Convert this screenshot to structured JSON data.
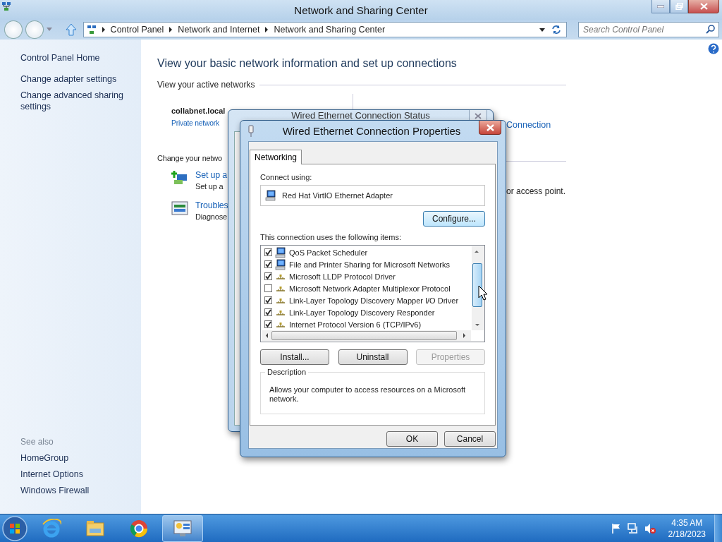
{
  "window": {
    "title": "Network and Sharing Center"
  },
  "address_bar": {
    "breadcrumbs": [
      "Control Panel",
      "Network and Internet",
      "Network and Sharing Center"
    ]
  },
  "search": {
    "placeholder": "Search Control Panel"
  },
  "sidebar": {
    "items": [
      "Control Panel Home",
      "Change adapter settings",
      "Change advanced sharing settings"
    ],
    "see_also_heading": "See also",
    "see_also": [
      "HomeGroup",
      "Internet Options",
      "Windows Firewall"
    ]
  },
  "main": {
    "heading": "View your basic network information and set up connections",
    "active_networks_label": "View your active networks",
    "network_name": "collabnet.local",
    "network_type": "Private network",
    "connection_link": "Connection",
    "change_label": "Change your netwo",
    "tasks": [
      {
        "kind": "setup",
        "link": "Set up a",
        "description": "Set up a",
        "description_tail": "or access point."
      },
      {
        "kind": "troubleshoot",
        "link": "Troubles",
        "description": "Diagnose"
      }
    ]
  },
  "status_window": {
    "title": "Wired Ethernet Connection Status"
  },
  "dialog": {
    "title": "Wired Ethernet Connection Properties",
    "tabs": [
      {
        "label": "Networking",
        "selected": true
      }
    ],
    "connect_using_label": "Connect using:",
    "adapter": "Red Hat VirtIO Ethernet Adapter",
    "configure_button": "Configure...",
    "items_label": "This connection uses the following items:",
    "items": [
      {
        "kind": "service",
        "label": "QoS Packet Scheduler",
        "checked": true
      },
      {
        "kind": "service",
        "label": "File and Printer Sharing for Microsoft Networks",
        "checked": true
      },
      {
        "kind": "protocol",
        "label": "Microsoft LLDP Protocol Driver",
        "checked": true
      },
      {
        "kind": "protocol",
        "label": "Microsoft Network Adapter Multiplexor Protocol",
        "checked": false
      },
      {
        "kind": "protocol",
        "label": "Link-Layer Topology Discovery Mapper I/O Driver",
        "checked": true
      },
      {
        "kind": "protocol",
        "label": "Link-Layer Topology Discovery Responder",
        "checked": true
      },
      {
        "kind": "protocol",
        "label": "Internet Protocol Version 6 (TCP/IPv6)",
        "checked": true
      }
    ],
    "buttons": [
      {
        "label": "Install...",
        "disabled": false
      },
      {
        "label": "Uninstall",
        "disabled": false
      },
      {
        "label": "Properties",
        "disabled": true
      }
    ],
    "description_label": "Description",
    "description": "Allows your computer to access resources on a Microsoft network.",
    "ok": "OK",
    "cancel": "Cancel"
  },
  "taskbar": {
    "apps": [
      {
        "kind": "browser-e",
        "selected": false
      },
      {
        "kind": "folder",
        "selected": false
      },
      {
        "kind": "browser-ring",
        "selected": false
      },
      {
        "kind": "control-panel",
        "selected": true
      }
    ],
    "time": "4:35 AM",
    "date": "2/18/2023"
  }
}
